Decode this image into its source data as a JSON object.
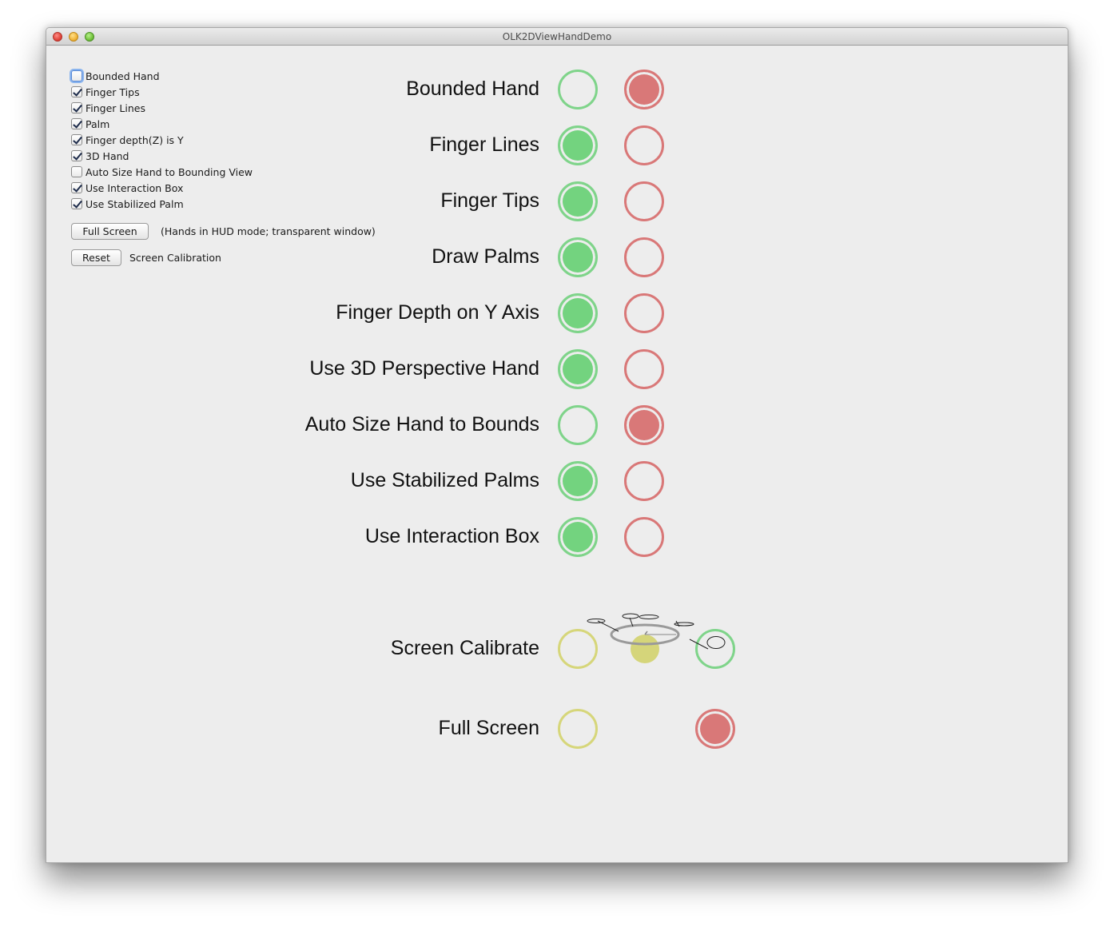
{
  "window": {
    "title": "OLK2DViewHandDemo"
  },
  "checkboxes": [
    {
      "label": "Bounded Hand",
      "checked": false,
      "focused": true
    },
    {
      "label": "Finger Tips",
      "checked": true,
      "focused": false
    },
    {
      "label": "Finger Lines",
      "checked": true,
      "focused": false
    },
    {
      "label": "Palm",
      "checked": true,
      "focused": false
    },
    {
      "label": "Finger depth(Z) is Y",
      "checked": true,
      "focused": false
    },
    {
      "label": "3D Hand",
      "checked": true,
      "focused": false
    },
    {
      "label": "Auto Size Hand to Bounding View",
      "checked": false,
      "focused": false
    },
    {
      "label": "Use Interaction Box",
      "checked": true,
      "focused": false
    },
    {
      "label": "Use Stabilized Palm",
      "checked": true,
      "focused": false
    }
  ],
  "buttons": {
    "full_screen_label": "Full Screen",
    "full_screen_note": "(Hands in HUD mode; transparent window)",
    "reset_label": "Reset",
    "reset_note": "Screen Calibration"
  },
  "options": [
    {
      "label": "Bounded Hand",
      "on": false
    },
    {
      "label": "Finger Lines",
      "on": true
    },
    {
      "label": "Finger Tips",
      "on": true
    },
    {
      "label": "Draw Palms",
      "on": true
    },
    {
      "label": "Finger Depth on Y Axis",
      "on": true
    },
    {
      "label": "Use 3D Perspective Hand",
      "on": true
    },
    {
      "label": "Auto Size Hand to Bounds",
      "on": false
    },
    {
      "label": "Use Stabilized Palms",
      "on": true
    },
    {
      "label": "Use Interaction Box",
      "on": true
    }
  ],
  "actions": [
    {
      "label": "Screen Calibrate",
      "hovered_side": "green"
    },
    {
      "label": "Full Screen",
      "hovered_side": "red"
    }
  ],
  "colors": {
    "green": "#73d37f",
    "red": "#d97878",
    "yellow": "#d6d67a",
    "window_bg": "#ededed"
  }
}
